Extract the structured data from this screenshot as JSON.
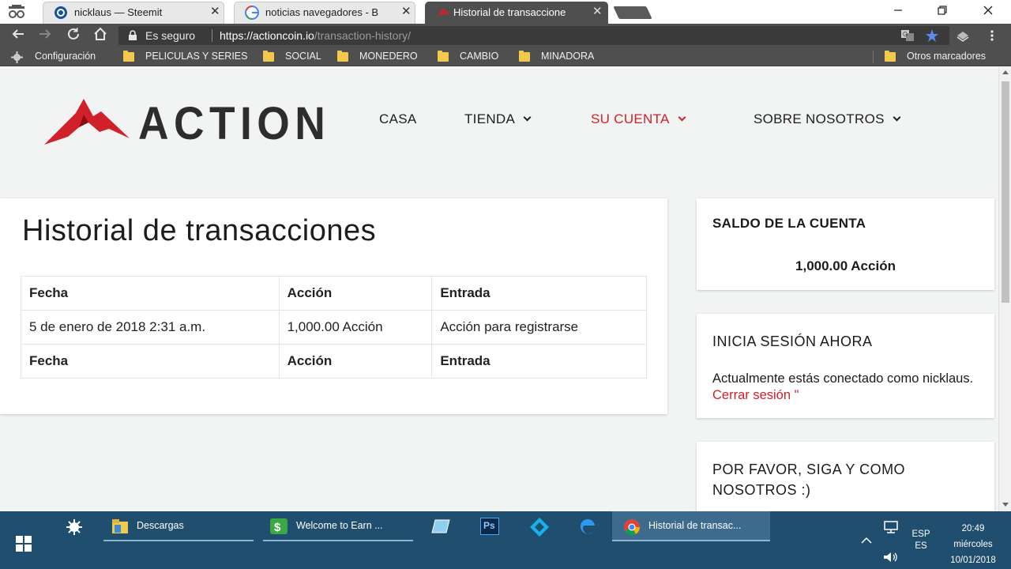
{
  "browser": {
    "tabs": [
      {
        "title": "nicklaus — Steemit",
        "favicon": "steemit-icon"
      },
      {
        "title": "noticias navegadores - B",
        "favicon": "google-icon"
      },
      {
        "title": "Historial de transaccione",
        "favicon": "action-logo-icon",
        "active": true
      }
    ],
    "close_glyph": "✕",
    "security_label": "Es seguro",
    "url_base": "https://actioncoin.io",
    "url_path": "/transaction-history/",
    "bookmarks": [
      {
        "label": "Configuración",
        "icon": "gear-icon"
      },
      {
        "label": "PELICULAS Y SERIES",
        "icon": "folder-icon"
      },
      {
        "label": "SOCIAL",
        "icon": "folder-icon"
      },
      {
        "label": "MONEDERO",
        "icon": "folder-icon"
      },
      {
        "label": "CAMBIO",
        "icon": "folder-icon"
      },
      {
        "label": "MINADORA",
        "icon": "folder-icon"
      }
    ],
    "other_bookmarks": "Otros marcadores"
  },
  "site": {
    "logo_text": "ACTION",
    "brand_color": "#d0202a",
    "nav": [
      {
        "label": "CASA",
        "dropdown": false
      },
      {
        "label": "TIENDA",
        "dropdown": true
      },
      {
        "label": "SU CUENTA",
        "dropdown": true,
        "active": true
      },
      {
        "label": "SOBRE NOSOTROS",
        "dropdown": true
      }
    ]
  },
  "main": {
    "title": "Historial de transacciones",
    "table": {
      "headers": [
        "Fecha",
        "Acción",
        "Entrada"
      ],
      "rows": [
        [
          "5 de enero de 2018 2:31 a.m.",
          "1,000.00 Acción",
          "Acción para registrarse"
        ]
      ],
      "footers": [
        "Fecha",
        "Acción",
        "Entrada"
      ]
    }
  },
  "sidebar": {
    "balance": {
      "title": "SALDO DE LA CUENTA",
      "value": "1,000.00 Acción"
    },
    "login": {
      "title": "INICIA SESIÓN AHORA",
      "text": "Actualmente estás conectado como nicklaus.",
      "logout_label": "Cerrar sesión \""
    },
    "follow": {
      "title": "POR FAVOR, SIGA Y COMO NOSOTROS :)"
    }
  },
  "taskbar": {
    "items": [
      {
        "label": "Descargas",
        "icon": "folder-icon"
      },
      {
        "label": "Welcome to Earn ...",
        "icon": "earn-app-icon"
      },
      {
        "label": "",
        "icon": "notepad-icon"
      },
      {
        "label": "Ps",
        "icon": "photoshop-icon"
      },
      {
        "label": "",
        "icon": "kodi-icon"
      },
      {
        "label": "",
        "icon": "edge-icon"
      },
      {
        "label": "Historial de transac...",
        "icon": "chrome-icon",
        "active": true
      }
    ],
    "language": "ESP",
    "language_sub": "ES",
    "time": "20:49",
    "day": "miércoles",
    "date": "10/01/2018"
  }
}
